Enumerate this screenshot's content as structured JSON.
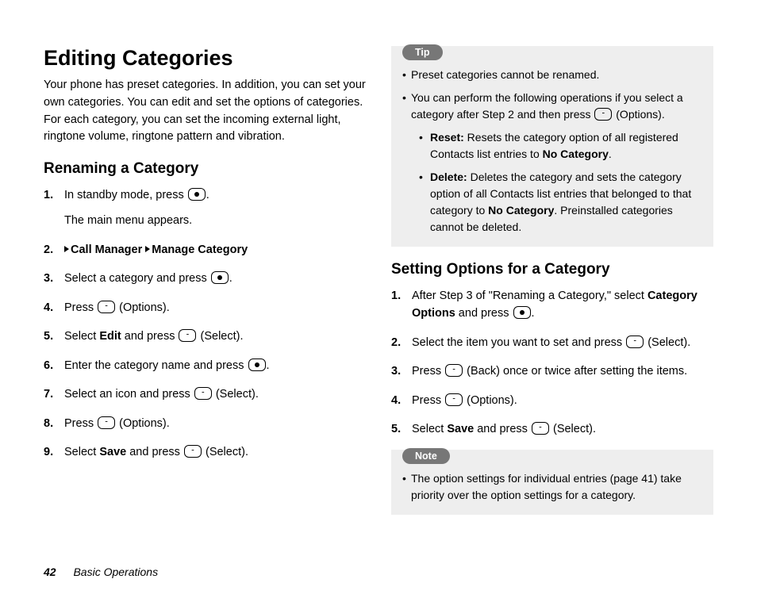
{
  "title": "Editing Categories",
  "intro": "Your phone has preset categories. In addition, you can set your own categories. You can edit and set the options of categories. For each category, you can set the incoming external light, ringtone volume, ringtone pattern and vibration.",
  "renaming": {
    "heading": "Renaming a Category",
    "steps": {
      "s1_a": "In standby mode, press ",
      "s1_b": ".",
      "s1_sub": "The main menu appears.",
      "s2_a": "Call Manager",
      "s2_b": "Manage Category",
      "s3_a": "Select a category and press ",
      "s3_b": ".",
      "s4_a": "Press ",
      "s4_b": " (Options).",
      "s5_a": "Select ",
      "s5_bold": "Edit",
      "s5_b": " and press ",
      "s5_c": " (Select).",
      "s6_a": "Enter the category name and press ",
      "s6_b": ".",
      "s7_a": "Select an icon and press ",
      "s7_b": " (Select).",
      "s8_a": "Press ",
      "s8_b": " (Options).",
      "s9_a": "Select ",
      "s9_bold": "Save",
      "s9_b": " and press ",
      "s9_c": " (Select)."
    }
  },
  "tip": {
    "label": "Tip",
    "items": {
      "t1": "Preset categories cannot be renamed.",
      "t2_a": "You can perform the following operations if you select a category after Step 2 and then press ",
      "t2_b": " (Options).",
      "reset_label": "Reset:",
      "reset_text": " Resets the category option of all registered Contacts list entries to ",
      "reset_bold": "No Category",
      "reset_end": ".",
      "delete_label": "Delete:",
      "delete_text": " Deletes the category and sets the category option of all Contacts list entries that belonged to that category to ",
      "delete_bold": "No Category",
      "delete_end": ". Preinstalled categories cannot be deleted."
    }
  },
  "setting": {
    "heading": "Setting Options for a Category",
    "steps": {
      "s1_a": "After Step 3 of \"Renaming a Category,\" select ",
      "s1_bold": "Category Options",
      "s1_b": " and press ",
      "s1_c": ".",
      "s2_a": "Select the item you want to set and press ",
      "s2_b": " (Select).",
      "s3_a": "Press ",
      "s3_b": " (Back) once or twice after setting the items.",
      "s4_a": "Press ",
      "s4_b": " (Options).",
      "s5_a": "Select ",
      "s5_bold": "Save",
      "s5_b": " and press ",
      "s5_c": " (Select)."
    }
  },
  "note": {
    "label": "Note",
    "n1": "The option settings for individual entries (page 41) take priority over the option settings for a category."
  },
  "footer": {
    "page": "42",
    "section": "Basic Operations"
  }
}
